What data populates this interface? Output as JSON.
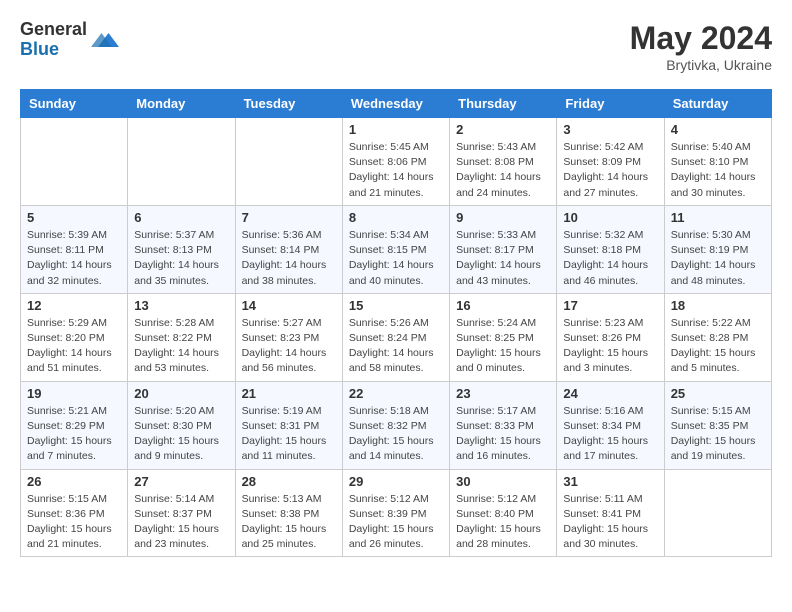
{
  "header": {
    "logo_general": "General",
    "logo_blue": "Blue",
    "month": "May 2024",
    "location": "Brytivka, Ukraine"
  },
  "days_of_week": [
    "Sunday",
    "Monday",
    "Tuesday",
    "Wednesday",
    "Thursday",
    "Friday",
    "Saturday"
  ],
  "weeks": [
    [
      {
        "day": "",
        "info": ""
      },
      {
        "day": "",
        "info": ""
      },
      {
        "day": "",
        "info": ""
      },
      {
        "day": "1",
        "info": "Sunrise: 5:45 AM\nSunset: 8:06 PM\nDaylight: 14 hours and 21 minutes."
      },
      {
        "day": "2",
        "info": "Sunrise: 5:43 AM\nSunset: 8:08 PM\nDaylight: 14 hours and 24 minutes."
      },
      {
        "day": "3",
        "info": "Sunrise: 5:42 AM\nSunset: 8:09 PM\nDaylight: 14 hours and 27 minutes."
      },
      {
        "day": "4",
        "info": "Sunrise: 5:40 AM\nSunset: 8:10 PM\nDaylight: 14 hours and 30 minutes."
      }
    ],
    [
      {
        "day": "5",
        "info": "Sunrise: 5:39 AM\nSunset: 8:11 PM\nDaylight: 14 hours and 32 minutes."
      },
      {
        "day": "6",
        "info": "Sunrise: 5:37 AM\nSunset: 8:13 PM\nDaylight: 14 hours and 35 minutes."
      },
      {
        "day": "7",
        "info": "Sunrise: 5:36 AM\nSunset: 8:14 PM\nDaylight: 14 hours and 38 minutes."
      },
      {
        "day": "8",
        "info": "Sunrise: 5:34 AM\nSunset: 8:15 PM\nDaylight: 14 hours and 40 minutes."
      },
      {
        "day": "9",
        "info": "Sunrise: 5:33 AM\nSunset: 8:17 PM\nDaylight: 14 hours and 43 minutes."
      },
      {
        "day": "10",
        "info": "Sunrise: 5:32 AM\nSunset: 8:18 PM\nDaylight: 14 hours and 46 minutes."
      },
      {
        "day": "11",
        "info": "Sunrise: 5:30 AM\nSunset: 8:19 PM\nDaylight: 14 hours and 48 minutes."
      }
    ],
    [
      {
        "day": "12",
        "info": "Sunrise: 5:29 AM\nSunset: 8:20 PM\nDaylight: 14 hours and 51 minutes."
      },
      {
        "day": "13",
        "info": "Sunrise: 5:28 AM\nSunset: 8:22 PM\nDaylight: 14 hours and 53 minutes."
      },
      {
        "day": "14",
        "info": "Sunrise: 5:27 AM\nSunset: 8:23 PM\nDaylight: 14 hours and 56 minutes."
      },
      {
        "day": "15",
        "info": "Sunrise: 5:26 AM\nSunset: 8:24 PM\nDaylight: 14 hours and 58 minutes."
      },
      {
        "day": "16",
        "info": "Sunrise: 5:24 AM\nSunset: 8:25 PM\nDaylight: 15 hours and 0 minutes."
      },
      {
        "day": "17",
        "info": "Sunrise: 5:23 AM\nSunset: 8:26 PM\nDaylight: 15 hours and 3 minutes."
      },
      {
        "day": "18",
        "info": "Sunrise: 5:22 AM\nSunset: 8:28 PM\nDaylight: 15 hours and 5 minutes."
      }
    ],
    [
      {
        "day": "19",
        "info": "Sunrise: 5:21 AM\nSunset: 8:29 PM\nDaylight: 15 hours and 7 minutes."
      },
      {
        "day": "20",
        "info": "Sunrise: 5:20 AM\nSunset: 8:30 PM\nDaylight: 15 hours and 9 minutes."
      },
      {
        "day": "21",
        "info": "Sunrise: 5:19 AM\nSunset: 8:31 PM\nDaylight: 15 hours and 11 minutes."
      },
      {
        "day": "22",
        "info": "Sunrise: 5:18 AM\nSunset: 8:32 PM\nDaylight: 15 hours and 14 minutes."
      },
      {
        "day": "23",
        "info": "Sunrise: 5:17 AM\nSunset: 8:33 PM\nDaylight: 15 hours and 16 minutes."
      },
      {
        "day": "24",
        "info": "Sunrise: 5:16 AM\nSunset: 8:34 PM\nDaylight: 15 hours and 17 minutes."
      },
      {
        "day": "25",
        "info": "Sunrise: 5:15 AM\nSunset: 8:35 PM\nDaylight: 15 hours and 19 minutes."
      }
    ],
    [
      {
        "day": "26",
        "info": "Sunrise: 5:15 AM\nSunset: 8:36 PM\nDaylight: 15 hours and 21 minutes."
      },
      {
        "day": "27",
        "info": "Sunrise: 5:14 AM\nSunset: 8:37 PM\nDaylight: 15 hours and 23 minutes."
      },
      {
        "day": "28",
        "info": "Sunrise: 5:13 AM\nSunset: 8:38 PM\nDaylight: 15 hours and 25 minutes."
      },
      {
        "day": "29",
        "info": "Sunrise: 5:12 AM\nSunset: 8:39 PM\nDaylight: 15 hours and 26 minutes."
      },
      {
        "day": "30",
        "info": "Sunrise: 5:12 AM\nSunset: 8:40 PM\nDaylight: 15 hours and 28 minutes."
      },
      {
        "day": "31",
        "info": "Sunrise: 5:11 AM\nSunset: 8:41 PM\nDaylight: 15 hours and 30 minutes."
      },
      {
        "day": "",
        "info": ""
      }
    ]
  ]
}
